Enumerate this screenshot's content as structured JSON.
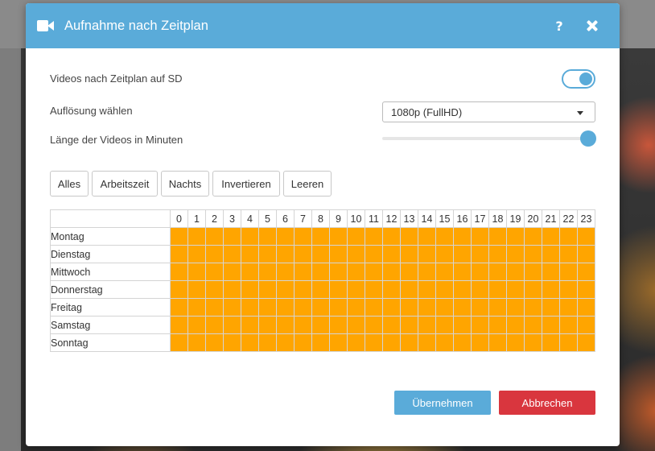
{
  "modal": {
    "title": "Aufnahme nach Zeitplan",
    "help_label": "?",
    "icon": "video-camera-icon",
    "accent_color": "#5aabd9"
  },
  "settings": {
    "sd_schedule_label": "Videos nach Zeitplan auf SD",
    "sd_schedule_enabled": true,
    "resolution_label": "Auflösung wählen",
    "resolution_value": "1080p (FullHD)",
    "length_label": "Länge der Videos in Minuten",
    "length_fraction": 1.0
  },
  "presets": {
    "all": "Alles",
    "work": "Arbeitszeit",
    "night": "Nachts",
    "invert": "Invertieren",
    "clear": "Leeren"
  },
  "schedule": {
    "hours": [
      "0",
      "1",
      "2",
      "3",
      "4",
      "5",
      "6",
      "7",
      "8",
      "9",
      "10",
      "11",
      "12",
      "13",
      "14",
      "15",
      "16",
      "17",
      "18",
      "19",
      "20",
      "21",
      "22",
      "23"
    ],
    "days": [
      "Montag",
      "Dienstag",
      "Mittwoch",
      "Donnerstag",
      "Freitag",
      "Samstag",
      "Sonntag"
    ],
    "active_color": "#ffa500",
    "all_active": true
  },
  "footer": {
    "apply_label": "Übernehmen",
    "cancel_label": "Abbrechen",
    "apply_color": "#5aabd9",
    "cancel_color": "#d9363e"
  }
}
